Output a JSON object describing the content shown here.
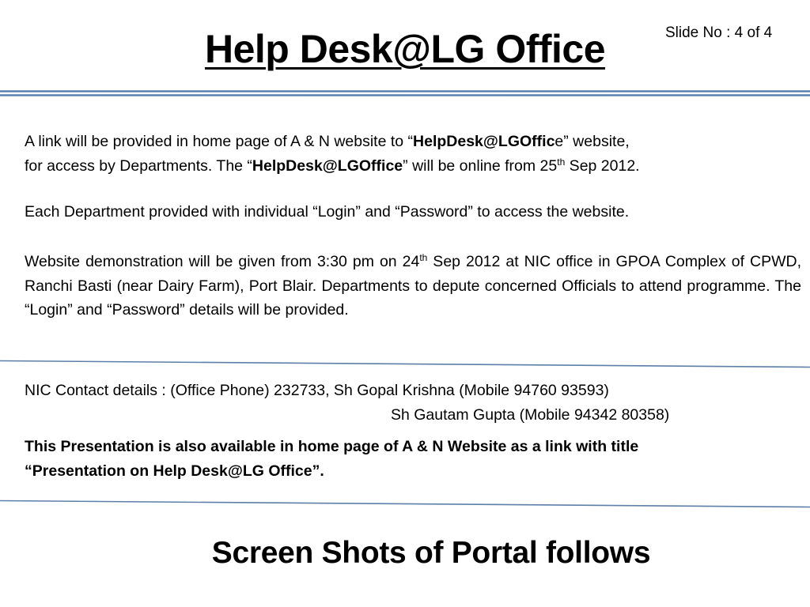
{
  "slide": {
    "title": "Help Desk@LG Office",
    "slide_number": "Slide No : 4 of 4",
    "colors": {
      "rule": "#4a74a5",
      "text": "#000000",
      "background": "#ffffff"
    }
  },
  "paragraph1": {
    "t1": "A link will be provided in home page of  A & N website to “",
    "b1": "HelpDesk@LGOffic",
    "t2": "e” website,",
    "t3": "for access by Departments. The “",
    "b2": "HelpDesk@LGOffice",
    "t4": "” will be online from 25",
    "sup": "th",
    "t5": " Sep 2012."
  },
  "paragraph2": "Each Department provided with individual “Login” and “Password” to access the website.",
  "paragraph3": {
    "t1": "Website demonstration will be given from 3:30 pm on 24",
    "sup": "th",
    "t2": " Sep 2012 at NIC  office in GPOA Complex of CPWD, Ranchi Basti (near Dairy Farm), Port Blair. Departments to depute concerned Officials to attend programme. The “Login” and “Password” details will be provided."
  },
  "contact": {
    "line1": "NIC Contact details : (Office Phone) 232733, Sh Gopal Krishna (Mobile 94760 93593)",
    "line2": "Sh Gautam Gupta (Mobile 94342 80358)"
  },
  "availability_note": {
    "line1": "This Presentation is also available in home page of A & N Website as a link with title",
    "line2": "“Presentation on Help Desk@LG Office”."
  },
  "footer": "Screen Shots of Portal follows"
}
